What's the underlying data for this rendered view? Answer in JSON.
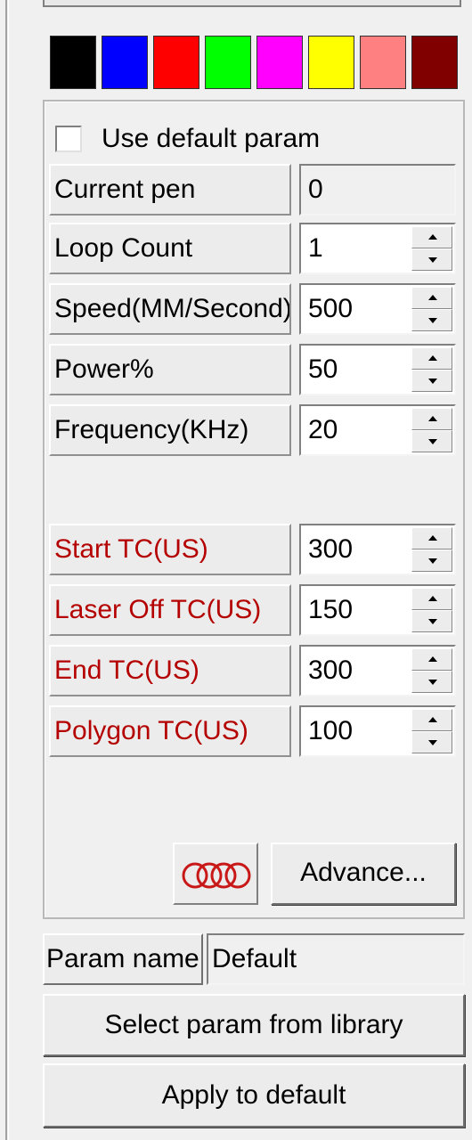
{
  "colors": {
    "pens": [
      "#000000",
      "#0000ff",
      "#ff0000",
      "#00ff00",
      "#ff00ff",
      "#ffff00",
      "#ff8080",
      "#800000"
    ],
    "tc_label_color": "#b40000"
  },
  "use_default": {
    "label": "Use default param",
    "checked": false
  },
  "params": [
    {
      "label": "Current pen",
      "value": "0",
      "readonly": true
    },
    {
      "label": "Loop Count",
      "value": "1"
    },
    {
      "label": "Speed(MM/Second)",
      "value": "500"
    },
    {
      "label": "Power%",
      "value": "50"
    },
    {
      "label": "Frequency(KHz)",
      "value": "20"
    }
  ],
  "tc_params": [
    {
      "label": "Start TC(US)",
      "value": "300"
    },
    {
      "label": "Laser Off TC(US)",
      "value": "150"
    },
    {
      "label": "End TC(US)",
      "value": "300"
    },
    {
      "label": "Polygon TC(US)",
      "value": "100"
    }
  ],
  "buttons": {
    "advance": "Advance...",
    "select_library": "Select param from library",
    "apply_default": "Apply to default"
  },
  "param_name": {
    "label": "Param name",
    "value": "Default"
  },
  "icons": {
    "logo": "four-rings-logo-icon",
    "spin_up": "spin-up-arrow-icon",
    "spin_down": "spin-down-arrow-icon"
  }
}
